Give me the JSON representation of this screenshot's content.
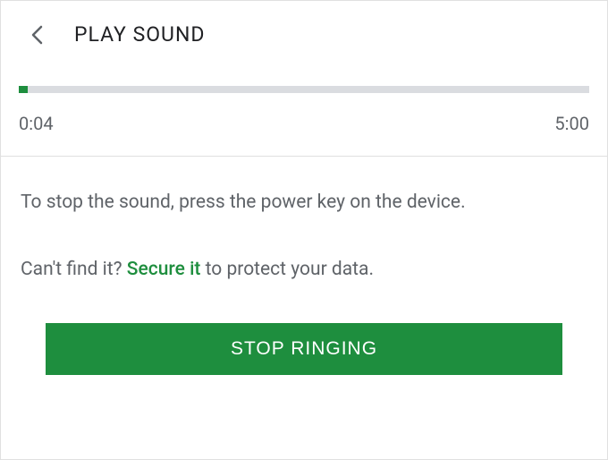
{
  "header": {
    "title": "PLAY SOUND"
  },
  "progress": {
    "elapsed": "0:04",
    "total": "5:00",
    "percent": 1.5
  },
  "instruction": "To stop the sound, press the power key on the device.",
  "secondary": {
    "prefix": "Can't find it? ",
    "link": "Secure it",
    "suffix": " to protect your data."
  },
  "button": {
    "label": "STOP RINGING"
  },
  "colors": {
    "accent": "#1e8e3e"
  }
}
